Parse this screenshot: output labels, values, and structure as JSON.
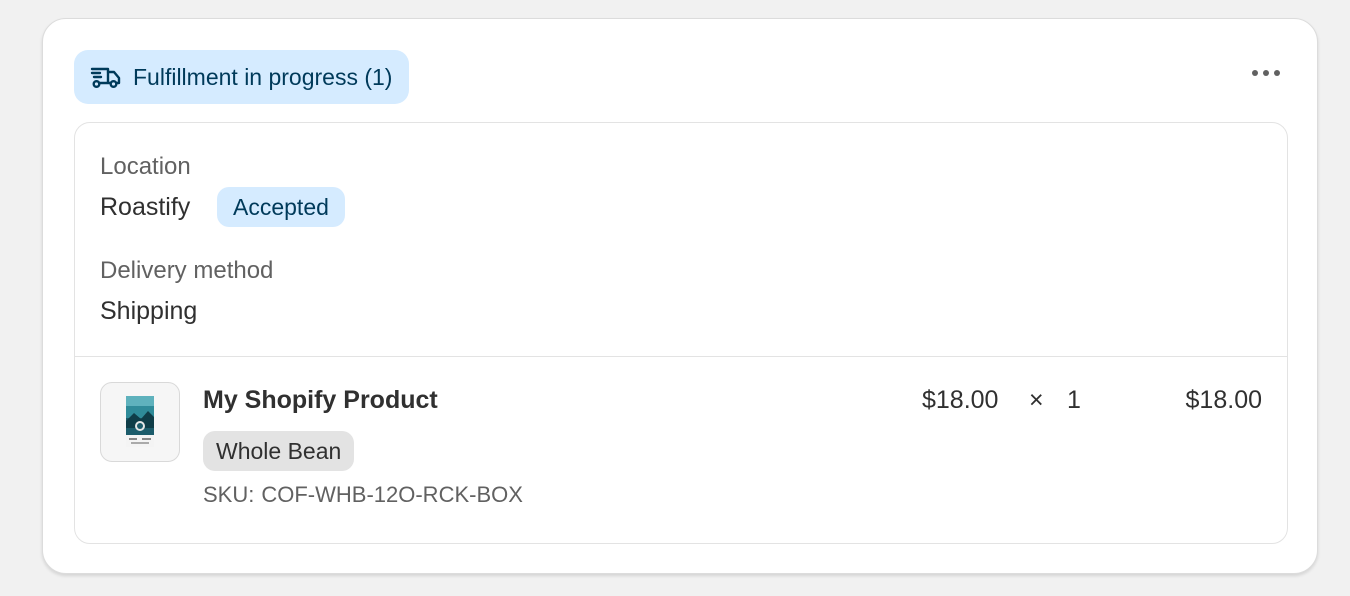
{
  "header": {
    "status_label": "Fulfillment in progress (1)",
    "status_icon": "delivery-truck-icon",
    "more_icon": "more-horizontal-icon"
  },
  "details": {
    "location_label": "Location",
    "location_value": "Roastify",
    "location_badge": "Accepted",
    "delivery_label": "Delivery method",
    "delivery_value": "Shipping"
  },
  "line_item": {
    "thumbnail_icon": "coffee-bag-image",
    "title": "My Shopify Product",
    "variant": "Whole Bean",
    "sku_label": "SKU:",
    "sku_value": "COF-WHB-12O-RCK-BOX",
    "unit_price": "$18.00",
    "times_symbol": "×",
    "quantity": "1",
    "total": "$18.00"
  },
  "colors": {
    "info_badge_bg": "#d5ebff",
    "info_badge_text": "#003a5a",
    "neutral_badge_bg": "#e3e3e3",
    "page_bg": "#f1f1f1"
  }
}
